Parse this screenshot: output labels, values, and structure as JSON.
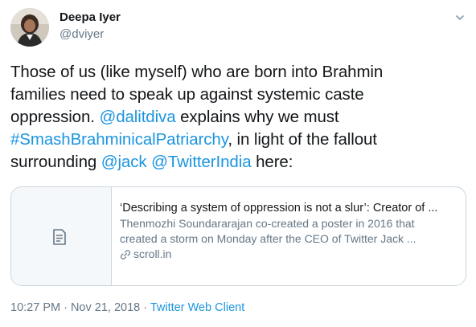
{
  "user": {
    "display_name": "Deepa Iyer",
    "handle": "@dviyer"
  },
  "tweet": {
    "line1": "Those of us (like myself) who are born into Brahmin",
    "line2": "families need to speak up against systemic caste",
    "line3_text": "oppression. ",
    "mention_dalitdiva": "@dalitdiva",
    "line3_rest": " explains why we must",
    "hashtag": "#SmashBrahminicalPatriarchy",
    "line4_rest": ", in light of the fallout",
    "line5_text": "surrounding ",
    "mention_jack": "@jack",
    "space": " ",
    "mention_twitterindia": "@TwitterIndia",
    "line5_rest": " here:"
  },
  "card": {
    "title": "‘Describing a system of oppression is not a slur’: Creator of ...",
    "desc_line1": "Thenmozhi Soundararajan co-created a poster in 2016 that",
    "desc_line2": "created a storm on Monday after the CEO of Twitter Jack ...",
    "domain": "scroll.in"
  },
  "meta": {
    "time": "10:27 PM · Nov 21, 2018 · ",
    "source": "Twitter Web Client"
  },
  "colors": {
    "link": "#1b95e0",
    "secondary_text": "#657786",
    "border": "#ccd6dd"
  },
  "icons": [
    "chevron-down-icon",
    "document-icon",
    "link-icon"
  ]
}
